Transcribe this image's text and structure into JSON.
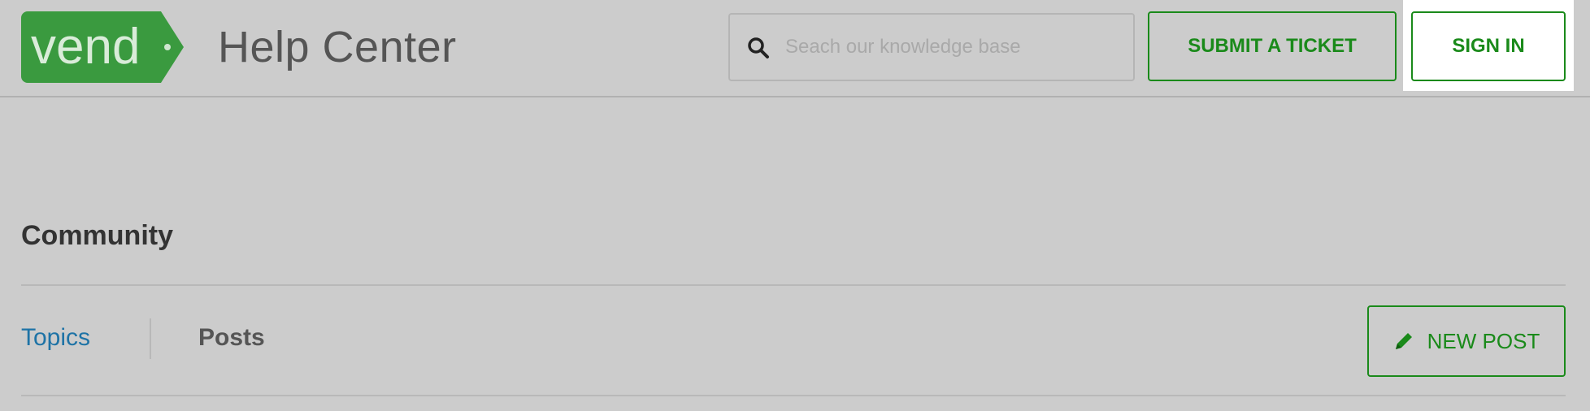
{
  "header": {
    "logo_text": "vend",
    "site_title": "Help Center",
    "search": {
      "placeholder": "Seach our knowledge base",
      "value": "",
      "icon": "search-icon"
    },
    "submit_ticket_label": "SUBMIT A TICKET",
    "sign_in_label": "SIGN IN"
  },
  "main": {
    "heading": "Community",
    "tabs": [
      {
        "label": "Topics",
        "active": true
      },
      {
        "label": "Posts",
        "active": false
      }
    ],
    "new_post_label": "NEW POST",
    "new_post_icon": "pencil-icon"
  },
  "colors": {
    "background": "#cccccc",
    "brand_green": "#3a9a3f",
    "button_green": "#1a8a1a",
    "link_blue": "#1e73a6",
    "title_gray": "#555555"
  }
}
